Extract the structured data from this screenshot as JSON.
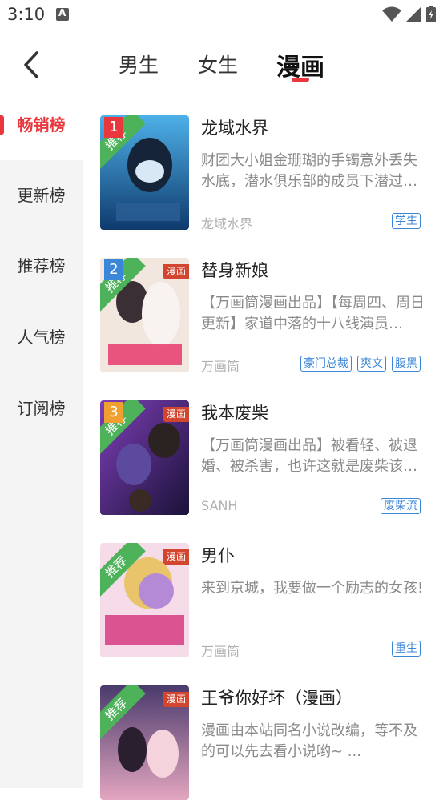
{
  "status_bar": {
    "time": "3:10",
    "icons": [
      "notification-a-icon",
      "wifi-icon",
      "signal-icon",
      "battery-icon"
    ]
  },
  "header": {
    "back_icon": "chevron-left-icon",
    "tabs": [
      {
        "label": "男生",
        "active": false
      },
      {
        "label": "女生",
        "active": false
      },
      {
        "label": "漫画",
        "active": true
      }
    ],
    "accent_color": "#e8383d"
  },
  "sidebar": {
    "items": [
      {
        "label": "畅销榜",
        "active": true
      },
      {
        "label": "更新榜",
        "active": false
      },
      {
        "label": "推荐榜",
        "active": false
      },
      {
        "label": "人气榜",
        "active": false
      },
      {
        "label": "订阅榜",
        "active": false
      }
    ]
  },
  "books": [
    {
      "rank": "1",
      "title": "龙域水界",
      "desc": "财团大小姐金珊瑚的手镯意外丢失水底，潜水俱乐部的成员下潜过…",
      "author": "龙域水界",
      "tags": [
        "学生"
      ],
      "cover_badge": "",
      "rank_color": "#e8383d",
      "cover_colors": [
        "#3a9ad9",
        "#0e2f5c"
      ]
    },
    {
      "rank": "2",
      "title": "替身新娘",
      "desc": "【万画筒漫画出品】【每周四、周日更新】家道中落的十八线演员…",
      "author": "万画筒",
      "tags": [
        "豪门总裁",
        "爽文",
        "腹黑"
      ],
      "cover_badge": "漫画",
      "rank_color": "#3a86d8",
      "cover_colors": [
        "#f2e6dc",
        "#c9a58d"
      ]
    },
    {
      "rank": "3",
      "title": "我本废柴",
      "desc": "【万画筒漫画出品】被看轻、被退婚、被杀害，也许这就是废柴该…",
      "author": "SANH",
      "tags": [
        "废柴流"
      ],
      "cover_badge": "漫画",
      "rank_color": "#f0a030",
      "cover_colors": [
        "#5a3a8c",
        "#1e1638"
      ]
    },
    {
      "rank": "",
      "ribbon": "推荐",
      "title": "男仆",
      "desc": "来到京城，我要做一个励志的女孩!",
      "author": "万画筒",
      "tags": [
        "重生"
      ],
      "cover_badge": "漫画",
      "cover_colors": [
        "#f7d7e6",
        "#caa0d8"
      ]
    },
    {
      "rank": "",
      "ribbon": "推荐",
      "title": "王爷你好坏（漫画）",
      "desc": "漫画由本站同名小说改编，等不及的可以先去看小说哟~ ...",
      "author": "",
      "tags": [
        ""
      ],
      "cover_badge": "漫画",
      "cover_colors": [
        "#5e4a80",
        "#e9b6c8"
      ]
    }
  ]
}
